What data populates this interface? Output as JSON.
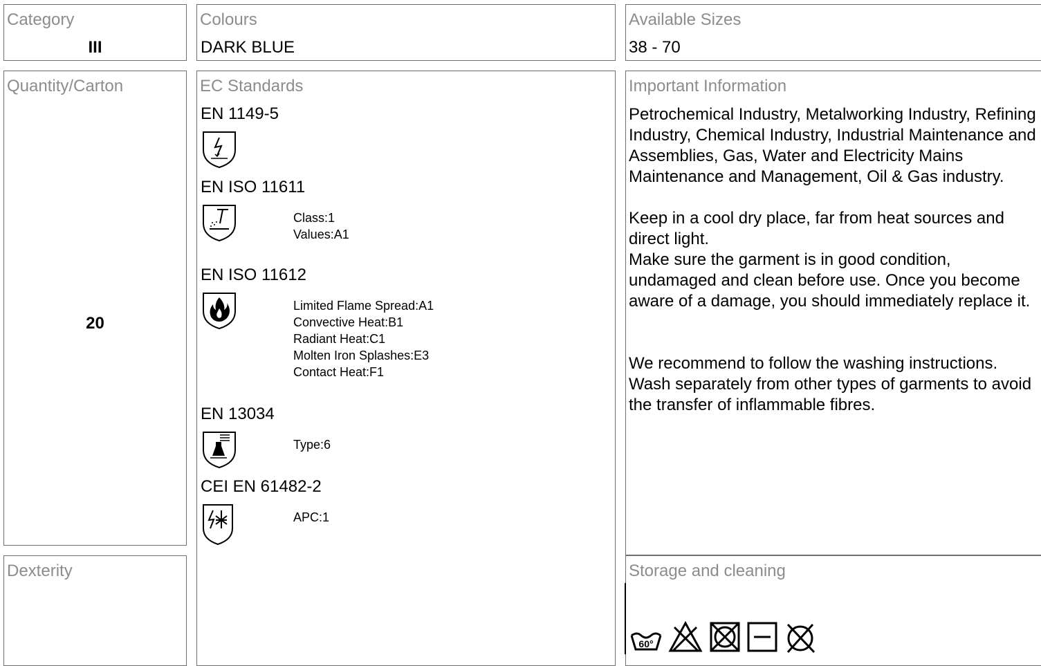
{
  "category": {
    "title": "Category",
    "value": "III"
  },
  "colours": {
    "title": "Colours",
    "value": "DARK BLUE"
  },
  "sizes": {
    "title": "Available Sizes",
    "value": "38 - 70"
  },
  "quantity": {
    "title": "Quantity/Carton",
    "value": "20"
  },
  "dexterity": {
    "title": "Dexterity"
  },
  "ec_standards": {
    "title": "EC Standards",
    "items": [
      {
        "name": "EN 1149-5",
        "icon": "electrostatic-shield-icon",
        "details": []
      },
      {
        "name": "EN ISO 11611",
        "icon": "welding-shield-icon",
        "details": [
          "Class:1",
          "Values:A1"
        ]
      },
      {
        "name": "EN ISO 11612",
        "icon": "flame-shield-icon",
        "details": [
          "Limited Flame Spread:A1",
          "Convective Heat:B1",
          "Radiant Heat:C1",
          "Molten Iron Splashes:E3",
          "Contact Heat:F1"
        ]
      },
      {
        "name": "EN 13034",
        "icon": "chemical-shield-icon",
        "details": [
          "Type:6"
        ]
      },
      {
        "name": "CEI EN 61482-2",
        "icon": "electric-arc-shield-icon",
        "details": [
          "APC:1"
        ]
      }
    ]
  },
  "important_info": {
    "title": "Important Information",
    "paragraphs": [
      "Petrochemical Industry, Metalworking Industry, Refining Industry, Chemical Industry, Industrial Maintenance and Assemblies, Gas, Water and Electricity Mains Maintenance and Management, Oil & Gas industry.",
      "",
      "Keep in a cool dry place, far from heat sources and direct light.",
      "Make sure the garment is in good condition, undamaged and clean before use. Once you become aware of a damage, you should immediately replace it.",
      "",
      "",
      "We recommend to follow the washing instructions. Wash separately from other types of garments to avoid the transfer of inflammable fibres."
    ]
  },
  "storage": {
    "title": "Storage and cleaning",
    "wash_temp": "60°",
    "icons": [
      "wash-60-icon",
      "no-bleach-icon",
      "no-tumble-dry-icon",
      "dry-flat-icon",
      "no-dry-clean-icon"
    ]
  }
}
